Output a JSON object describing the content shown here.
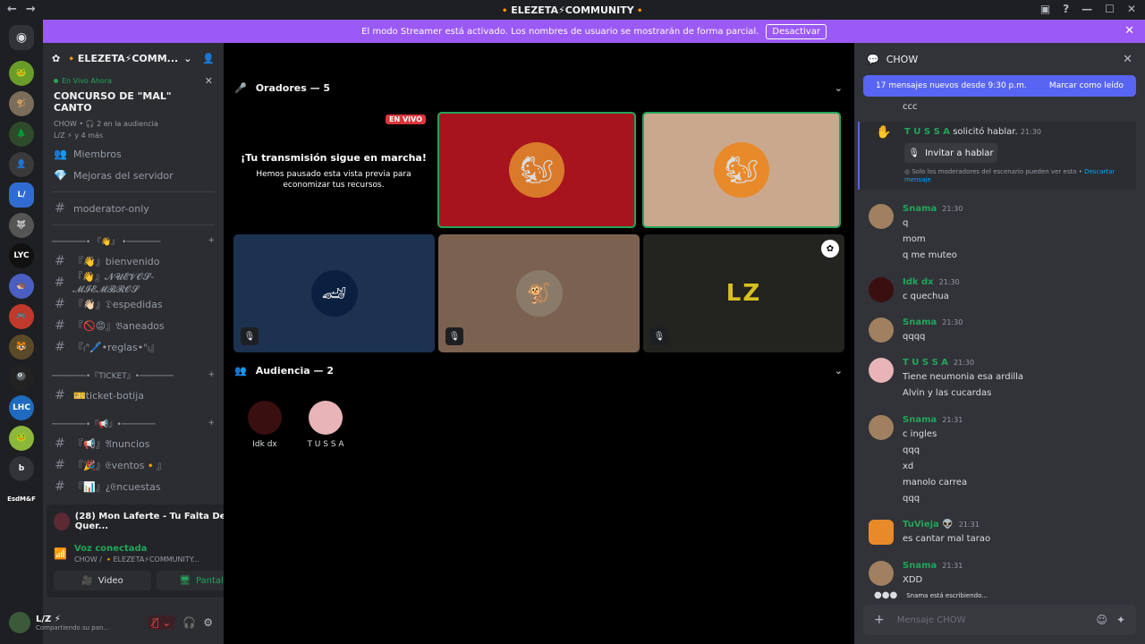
{
  "window": {
    "title": "🔸ELEZETA⚡COMMUNITY🔸",
    "nav_back": "←",
    "nav_fwd": "→",
    "controls": [
      "▣",
      "?",
      "—",
      "☐",
      "✕"
    ]
  },
  "banner": {
    "text": "El modo Streamer está activado. Los nombres de usuario se mostrarán de forma parcial.",
    "button": "Desactivar"
  },
  "rail": {
    "bottom_label": "EsdM&F",
    "b_label": "b",
    "lyc_label": "LYC",
    "lhc_label": "LHC"
  },
  "server": {
    "name": "🔸ELEZETA⚡COMM...",
    "live": {
      "tag": "En Vivo Ahora",
      "title": "CONCURSO DE \"MAL\" CANTO",
      "meta": "CHOW • 🎧 2 en la audiencia",
      "meta2": "L/Z ⚡ y 4 más"
    },
    "shortcuts": [
      {
        "label": "Miembros",
        "icon": "👥"
      },
      {
        "label": "Mejoras del servidor",
        "icon": "💎"
      }
    ],
    "channels_top": [
      {
        "name": "moderator-only"
      }
    ],
    "categories": [
      {
        "label": "───────• 『👋』 •───────",
        "channels": [
          "『👋』bienvenido",
          "『👋』𝓝𝓤𝓔𝓥𝓞𝓢-𝓜𝓘𝓔𝓜𝓑𝓡𝓞𝓢",
          "『👋🏻』𝔇espedidas",
          "『🚫😡』𝔅aneados",
          "『₍ᐢ🖊️•reglas•ᐢ₎』"
        ]
      },
      {
        "label": "───────•『TICKET』•───────",
        "channels": [
          "🎫ticket-botija"
        ]
      },
      {
        "label": "───────•『📢』•───────",
        "channels": [
          "『📢』𝔄nuncios",
          "『🎉』𝔈ventos🔸』",
          "『📊』¿𝔈ncuestas"
        ]
      }
    ]
  },
  "voice": {
    "now_playing": "(28) Mon Laferte - Tu Falta De Quer...",
    "status": "Voz conectada",
    "channel": "CHOW / 🔸ELEZETA⚡COMMUNITY...",
    "video": "Video",
    "screen": "Pantalla"
  },
  "user": {
    "name": "L/Z ⚡",
    "status": "Compartiendo su pan..."
  },
  "stage": {
    "speakers_label": "Oradores — 5",
    "audience_label": "Audiencia — 2",
    "preview_title": "¡Tu transmisión sigue en marcha!",
    "preview_body": "Hemos pausado esta vista previa para economizar tus recursos.",
    "live_badge": "EN VIVO",
    "tile_lz_text": "LZ",
    "audience": [
      {
        "name": "Idk dx",
        "color": "#3a0f10"
      },
      {
        "name": "T U S S A",
        "color": "#e8b4b8"
      }
    ]
  },
  "chat": {
    "channel": "CHOW",
    "new_bar": "17 mensajes nuevos desde 9:30 p.m.",
    "mark_read": "Marcar como leído",
    "top_line": "ccc",
    "request": {
      "name": "T U S S A",
      "text": "solicitó hablar.",
      "time": "21:30",
      "button": "Invitar a hablar",
      "note": "Solo los moderadores del escenario pueden ver esto •",
      "dismiss": "Descartar mensaje"
    },
    "messages": [
      {
        "name": "Snama",
        "time": "21:30",
        "color": "#23a55a",
        "lines": [
          "q",
          "mom",
          "q me muteo"
        ]
      },
      {
        "name": "Idk dx",
        "time": "21:30",
        "color": "#23a55a",
        "lines": [
          "c quechua"
        ]
      },
      {
        "name": "Snama",
        "time": "21:30",
        "color": "#23a55a",
        "lines": [
          "qqqq"
        ]
      },
      {
        "name": "T U S S A",
        "time": "21:30",
        "color": "#23a55a",
        "lines": [
          "Tiene neumonia esa ardilla",
          "Alvin y las cucardas"
        ]
      },
      {
        "name": "Snama",
        "time": "21:31",
        "color": "#23a55a",
        "lines": [
          "c ingles",
          "qqq",
          "xd",
          "manolo carrea",
          "qqq"
        ]
      },
      {
        "name": "TuVieja 👽",
        "time": "21:31",
        "color": "#23a55a",
        "lines": [
          "es cantar mal tarao"
        ]
      },
      {
        "name": "Snama",
        "time": "21:31",
        "color": "#23a55a",
        "lines": [
          "XDD"
        ]
      }
    ],
    "typing": "Snama está escribiendo...",
    "placeholder": "Mensaje CHOW"
  },
  "colors": {
    "accent": "#5865f2",
    "streamer": "#9b59f6",
    "green": "#23a55a",
    "red": "#da373c"
  }
}
